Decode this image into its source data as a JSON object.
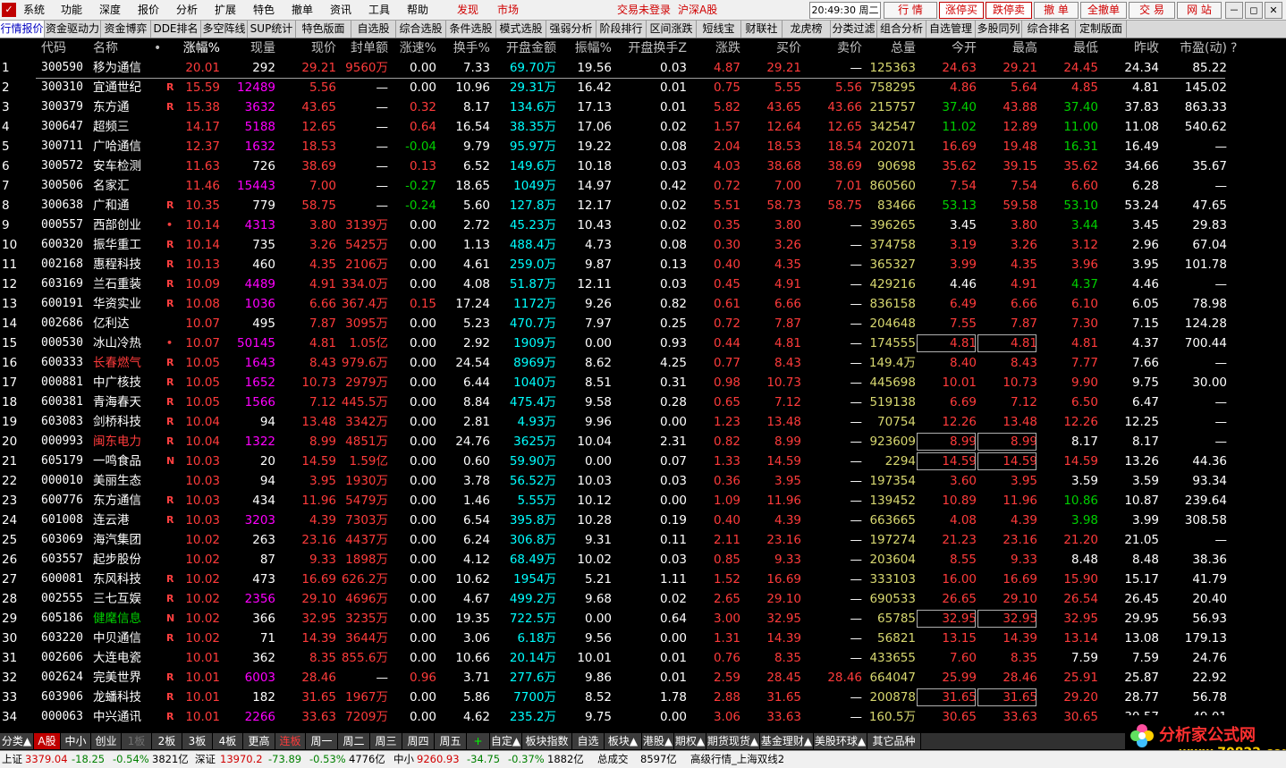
{
  "menu": {
    "items": [
      "系统",
      "功能",
      "深度",
      "报价",
      "分析",
      "扩展",
      "特色",
      "撤单",
      "资讯",
      "工具",
      "帮助"
    ],
    "discover": "发现",
    "market": "市场",
    "login_status": "交易未登录",
    "market_scope": "沪深A股",
    "clock": "20:49:30 周二",
    "buttons": [
      "行 情",
      "涨停买",
      "跌停卖",
      "撤 单",
      "全撤单",
      "交 易",
      "网 站"
    ],
    "win": [
      "－",
      "◻",
      "✕"
    ]
  },
  "tabs": [
    "行情报价",
    "资金驱动力",
    "资金博弈",
    "DDE排名",
    "多空阵线",
    "SUP统计",
    "特色版面",
    "自选股",
    "综合选股",
    "条件选股",
    "模式选股",
    "强弱分析",
    "阶段排行",
    "区间涨跌",
    "短线宝",
    "财联社",
    "龙虎榜",
    "分类过滤*",
    "组合分析",
    "自选管理",
    "多股同列",
    "综合排名",
    "定制版面"
  ],
  "columns": [
    "代码",
    "名称",
    "•",
    "涨幅%",
    "现量",
    "现价",
    "封单额",
    "涨速%",
    "换手%",
    "开盘金额",
    "振幅%",
    "开盘换手Z",
    "涨跌",
    "买价",
    "卖价",
    "总量",
    "今开",
    "最高",
    "最低",
    "昨收",
    "市盈(动)",
    "?"
  ],
  "rows": [
    {
      "i": "1",
      "code": "300590",
      "name": "移为通信",
      "f": "",
      "pct": "20.01",
      "vol": "292",
      "price": "29.21",
      "seal": "9560万",
      "spd": "0.00",
      "turn": "7.33",
      "amt": "69.70万",
      "amp": "19.56",
      "oturn": "0.03",
      "chg": "4.87",
      "bid": "29.21",
      "ask": "—",
      "tot": "125363",
      "open": "24.63",
      "high": "29.21",
      "low": "24.45",
      "prev": "24.34",
      "pe": "85.22"
    },
    {
      "i": "2",
      "code": "300310",
      "name": "宜通世纪",
      "f": "R",
      "pct": "15.59",
      "vol": "12489",
      "price": "5.56",
      "seal": "—",
      "spd": "0.00",
      "turn": "10.96",
      "amt": "29.31万",
      "amp": "16.42",
      "oturn": "0.01",
      "chg": "0.75",
      "bid": "5.55",
      "ask": "5.56",
      "tot": "758295",
      "open": "4.86",
      "high": "5.64",
      "low": "4.85",
      "prev": "4.81",
      "pe": "145.02"
    },
    {
      "i": "3",
      "code": "300379",
      "name": "东方通",
      "f": "R",
      "pct": "15.38",
      "vol": "3632",
      "price": "43.65",
      "seal": "—",
      "spd": "0.32",
      "turn": "8.17",
      "amt": "134.6万",
      "amp": "17.13",
      "oturn": "0.01",
      "chg": "5.82",
      "bid": "43.65",
      "ask": "43.66",
      "tot": "215757",
      "open": "37.40",
      "high": "43.88",
      "low": "37.40",
      "prev": "37.83",
      "pe": "863.33"
    },
    {
      "i": "4",
      "code": "300647",
      "name": "超频三",
      "f": "",
      "pct": "14.17",
      "vol": "5188",
      "price": "12.65",
      "seal": "—",
      "spd": "0.64",
      "turn": "16.54",
      "amt": "38.35万",
      "amp": "17.06",
      "oturn": "0.02",
      "chg": "1.57",
      "bid": "12.64",
      "ask": "12.65",
      "tot": "342547",
      "open": "11.02",
      "high": "12.89",
      "low": "11.00",
      "prev": "11.08",
      "pe": "540.62"
    },
    {
      "i": "5",
      "code": "300711",
      "name": "广哈通信",
      "f": "",
      "pct": "12.37",
      "vol": "1632",
      "price": "18.53",
      "seal": "—",
      "spd": "-0.04",
      "turn": "9.79",
      "amt": "95.97万",
      "amp": "19.22",
      "oturn": "0.08",
      "chg": "2.04",
      "bid": "18.53",
      "ask": "18.54",
      "tot": "202071",
      "open": "16.69",
      "high": "19.48",
      "low": "16.31",
      "prev": "16.49",
      "pe": "—"
    },
    {
      "i": "6",
      "code": "300572",
      "name": "安车检测",
      "f": "",
      "pct": "11.63",
      "vol": "726",
      "price": "38.69",
      "seal": "—",
      "spd": "0.13",
      "turn": "6.52",
      "amt": "149.6万",
      "amp": "10.18",
      "oturn": "0.03",
      "chg": "4.03",
      "bid": "38.68",
      "ask": "38.69",
      "tot": "90698",
      "open": "35.62",
      "high": "39.15",
      "low": "35.62",
      "prev": "34.66",
      "pe": "35.67"
    },
    {
      "i": "7",
      "code": "300506",
      "name": "名家汇",
      "f": "",
      "pct": "11.46",
      "vol": "15443",
      "price": "7.00",
      "seal": "—",
      "spd": "-0.27",
      "turn": "18.65",
      "amt": "1049万",
      "amp": "14.97",
      "oturn": "0.42",
      "chg": "0.72",
      "bid": "7.00",
      "ask": "7.01",
      "tot": "860560",
      "open": "7.54",
      "high": "7.54",
      "low": "6.60",
      "prev": "6.28",
      "pe": "—"
    },
    {
      "i": "8",
      "code": "300638",
      "name": "广和通",
      "f": "R",
      "pct": "10.35",
      "vol": "779",
      "price": "58.75",
      "seal": "—",
      "spd": "-0.24",
      "turn": "5.60",
      "amt": "127.8万",
      "amp": "12.17",
      "oturn": "0.02",
      "chg": "5.51",
      "bid": "58.73",
      "ask": "58.75",
      "tot": "83466",
      "open": "53.13",
      "high": "59.58",
      "low": "53.10",
      "prev": "53.24",
      "pe": "47.65"
    },
    {
      "i": "9",
      "code": "000557",
      "name": "西部创业",
      "f": "•",
      "pct": "10.14",
      "vol": "4313",
      "price": "3.80",
      "seal": "3139万",
      "spd": "0.00",
      "turn": "2.72",
      "amt": "45.23万",
      "amp": "10.43",
      "oturn": "0.02",
      "chg": "0.35",
      "bid": "3.80",
      "ask": "—",
      "tot": "396265",
      "open": "3.45",
      "high": "3.80",
      "low": "3.44",
      "prev": "3.45",
      "pe": "29.83"
    },
    {
      "i": "10",
      "code": "600320",
      "name": "振华重工",
      "f": "R",
      "pct": "10.14",
      "vol": "735",
      "price": "3.26",
      "seal": "5425万",
      "spd": "0.00",
      "turn": "1.13",
      "amt": "488.4万",
      "amp": "4.73",
      "oturn": "0.08",
      "chg": "0.30",
      "bid": "3.26",
      "ask": "—",
      "tot": "374758",
      "open": "3.19",
      "high": "3.26",
      "low": "3.12",
      "prev": "2.96",
      "pe": "67.04"
    },
    {
      "i": "11",
      "code": "002168",
      "name": "惠程科技",
      "f": "R",
      "pct": "10.13",
      "vol": "460",
      "price": "4.35",
      "seal": "2106万",
      "spd": "0.00",
      "turn": "4.61",
      "amt": "259.0万",
      "amp": "9.87",
      "oturn": "0.13",
      "chg": "0.40",
      "bid": "4.35",
      "ask": "—",
      "tot": "365327",
      "open": "3.99",
      "high": "4.35",
      "low": "3.96",
      "prev": "3.95",
      "pe": "101.78"
    },
    {
      "i": "12",
      "code": "603169",
      "name": "兰石重装",
      "f": "R",
      "pct": "10.09",
      "vol": "4489",
      "price": "4.91",
      "seal": "334.0万",
      "spd": "0.00",
      "turn": "4.08",
      "amt": "51.87万",
      "amp": "12.11",
      "oturn": "0.03",
      "chg": "0.45",
      "bid": "4.91",
      "ask": "—",
      "tot": "429216",
      "open": "4.46",
      "high": "4.91",
      "low": "4.37",
      "prev": "4.46",
      "pe": "—"
    },
    {
      "i": "13",
      "code": "600191",
      "name": "华资实业",
      "f": "R",
      "pct": "10.08",
      "vol": "1036",
      "price": "6.66",
      "seal": "367.4万",
      "spd": "0.15",
      "turn": "17.24",
      "amt": "1172万",
      "amp": "9.26",
      "oturn": "0.82",
      "chg": "0.61",
      "bid": "6.66",
      "ask": "—",
      "tot": "836158",
      "open": "6.49",
      "high": "6.66",
      "low": "6.10",
      "prev": "6.05",
      "pe": "78.98"
    },
    {
      "i": "14",
      "code": "002686",
      "name": "亿利达",
      "f": "",
      "pct": "10.07",
      "vol": "495",
      "price": "7.87",
      "seal": "3095万",
      "spd": "0.00",
      "turn": "5.23",
      "amt": "470.7万",
      "amp": "7.97",
      "oturn": "0.25",
      "chg": "0.72",
      "bid": "7.87",
      "ask": "—",
      "tot": "204648",
      "open": "7.55",
      "high": "7.87",
      "low": "7.30",
      "prev": "7.15",
      "pe": "124.28"
    },
    {
      "i": "15",
      "code": "000530",
      "name": "冰山冷热",
      "f": "•",
      "pct": "10.07",
      "vol": "50145",
      "price": "4.81",
      "seal": "1.05亿",
      "spd": "0.00",
      "turn": "2.92",
      "amt": "1909万",
      "amp": "0.00",
      "oturn": "0.93",
      "chg": "0.44",
      "bid": "4.81",
      "ask": "—",
      "tot": "174555",
      "open": "4.81",
      "high": "4.81",
      "low": "4.81",
      "prev": "4.37",
      "pe": "700.44"
    },
    {
      "i": "16",
      "code": "600333",
      "name": "长春燃气",
      "f": "R",
      "pct": "10.05",
      "vol": "1643",
      "price": "8.43",
      "seal": "979.6万",
      "spd": "0.00",
      "turn": "24.54",
      "amt": "8969万",
      "amp": "8.62",
      "oturn": "4.25",
      "chg": "0.77",
      "bid": "8.43",
      "ask": "—",
      "tot": "149.4万",
      "open": "8.40",
      "high": "8.43",
      "low": "7.77",
      "prev": "7.66",
      "pe": "—"
    },
    {
      "i": "17",
      "code": "000881",
      "name": "中广核技",
      "f": "R",
      "pct": "10.05",
      "vol": "1652",
      "price": "10.73",
      "seal": "2979万",
      "spd": "0.00",
      "turn": "6.44",
      "amt": "1040万",
      "amp": "8.51",
      "oturn": "0.31",
      "chg": "0.98",
      "bid": "10.73",
      "ask": "—",
      "tot": "445698",
      "open": "10.01",
      "high": "10.73",
      "low": "9.90",
      "prev": "9.75",
      "pe": "30.00"
    },
    {
      "i": "18",
      "code": "600381",
      "name": "青海春天",
      "f": "R",
      "pct": "10.05",
      "vol": "1566",
      "price": "7.12",
      "seal": "445.5万",
      "spd": "0.00",
      "turn": "8.84",
      "amt": "475.4万",
      "amp": "9.58",
      "oturn": "0.28",
      "chg": "0.65",
      "bid": "7.12",
      "ask": "—",
      "tot": "519138",
      "open": "6.69",
      "high": "7.12",
      "low": "6.50",
      "prev": "6.47",
      "pe": "—"
    },
    {
      "i": "19",
      "code": "603083",
      "name": "剑桥科技",
      "f": "R",
      "pct": "10.04",
      "vol": "94",
      "price": "13.48",
      "seal": "3342万",
      "spd": "0.00",
      "turn": "2.81",
      "amt": "4.93万",
      "amp": "9.96",
      "oturn": "0.00",
      "chg": "1.23",
      "bid": "13.48",
      "ask": "—",
      "tot": "70754",
      "open": "12.26",
      "high": "13.48",
      "low": "12.26",
      "prev": "12.25",
      "pe": "—"
    },
    {
      "i": "20",
      "code": "000993",
      "name": "闽东电力",
      "f": "R",
      "pct": "10.04",
      "vol": "1322",
      "price": "8.99",
      "seal": "4851万",
      "spd": "0.00",
      "turn": "24.76",
      "amt": "3625万",
      "amp": "10.04",
      "oturn": "2.31",
      "chg": "0.82",
      "bid": "8.99",
      "ask": "—",
      "tot": "923609",
      "open": "8.99",
      "high": "8.99",
      "low": "8.17",
      "prev": "8.17",
      "pe": "—"
    },
    {
      "i": "21",
      "code": "605179",
      "name": "一鸣食品",
      "f": "N",
      "pct": "10.03",
      "vol": "20",
      "price": "14.59",
      "seal": "1.59亿",
      "spd": "0.00",
      "turn": "0.60",
      "amt": "59.90万",
      "amp": "0.00",
      "oturn": "0.07",
      "chg": "1.33",
      "bid": "14.59",
      "ask": "—",
      "tot": "2294",
      "open": "14.59",
      "high": "14.59",
      "low": "14.59",
      "prev": "13.26",
      "pe": "44.36"
    },
    {
      "i": "22",
      "code": "000010",
      "name": "美丽生态",
      "f": "",
      "pct": "10.03",
      "vol": "94",
      "price": "3.95",
      "seal": "1930万",
      "spd": "0.00",
      "turn": "3.78",
      "amt": "56.52万",
      "amp": "10.03",
      "oturn": "0.03",
      "chg": "0.36",
      "bid": "3.95",
      "ask": "—",
      "tot": "197354",
      "open": "3.60",
      "high": "3.95",
      "low": "3.59",
      "prev": "3.59",
      "pe": "93.34"
    },
    {
      "i": "23",
      "code": "600776",
      "name": "东方通信",
      "f": "R",
      "pct": "10.03",
      "vol": "434",
      "price": "11.96",
      "seal": "5479万",
      "spd": "0.00",
      "turn": "1.46",
      "amt": "5.55万",
      "amp": "10.12",
      "oturn": "0.00",
      "chg": "1.09",
      "bid": "11.96",
      "ask": "—",
      "tot": "139452",
      "open": "10.89",
      "high": "11.96",
      "low": "10.86",
      "prev": "10.87",
      "pe": "239.64"
    },
    {
      "i": "24",
      "code": "601008",
      "name": "连云港",
      "f": "R",
      "pct": "10.03",
      "vol": "3203",
      "price": "4.39",
      "seal": "7303万",
      "spd": "0.00",
      "turn": "6.54",
      "amt": "395.8万",
      "amp": "10.28",
      "oturn": "0.19",
      "chg": "0.40",
      "bid": "4.39",
      "ask": "—",
      "tot": "663665",
      "open": "4.08",
      "high": "4.39",
      "low": "3.98",
      "prev": "3.99",
      "pe": "308.58"
    },
    {
      "i": "25",
      "code": "603069",
      "name": "海汽集团",
      "f": "",
      "pct": "10.02",
      "vol": "263",
      "price": "23.16",
      "seal": "4437万",
      "spd": "0.00",
      "turn": "6.24",
      "amt": "306.8万",
      "amp": "9.31",
      "oturn": "0.11",
      "chg": "2.11",
      "bid": "23.16",
      "ask": "—",
      "tot": "197274",
      "open": "21.23",
      "high": "23.16",
      "low": "21.20",
      "prev": "21.05",
      "pe": "—"
    },
    {
      "i": "26",
      "code": "603557",
      "name": "起步股份",
      "f": "",
      "pct": "10.02",
      "vol": "87",
      "price": "9.33",
      "seal": "1898万",
      "spd": "0.00",
      "turn": "4.12",
      "amt": "68.49万",
      "amp": "10.02",
      "oturn": "0.03",
      "chg": "0.85",
      "bid": "9.33",
      "ask": "—",
      "tot": "203604",
      "open": "8.55",
      "high": "9.33",
      "low": "8.48",
      "prev": "8.48",
      "pe": "38.36"
    },
    {
      "i": "27",
      "code": "600081",
      "name": "东风科技",
      "f": "R",
      "pct": "10.02",
      "vol": "473",
      "price": "16.69",
      "seal": "626.2万",
      "spd": "0.00",
      "turn": "10.62",
      "amt": "1954万",
      "amp": "5.21",
      "oturn": "1.11",
      "chg": "1.52",
      "bid": "16.69",
      "ask": "—",
      "tot": "333103",
      "open": "16.00",
      "high": "16.69",
      "low": "15.90",
      "prev": "15.17",
      "pe": "41.79"
    },
    {
      "i": "28",
      "code": "002555",
      "name": "三七互娱",
      "f": "R",
      "pct": "10.02",
      "vol": "2356",
      "price": "29.10",
      "seal": "4696万",
      "spd": "0.00",
      "turn": "4.67",
      "amt": "499.2万",
      "amp": "9.68",
      "oturn": "0.02",
      "chg": "2.65",
      "bid": "29.10",
      "ask": "—",
      "tot": "690533",
      "open": "26.65",
      "high": "29.10",
      "low": "26.54",
      "prev": "26.45",
      "pe": "20.40"
    },
    {
      "i": "29",
      "code": "605186",
      "name": "健麾信息",
      "f": "N",
      "pct": "10.02",
      "vol": "366",
      "price": "32.95",
      "seal": "3235万",
      "spd": "0.00",
      "turn": "19.35",
      "amt": "722.5万",
      "amp": "0.00",
      "oturn": "0.64",
      "chg": "3.00",
      "bid": "32.95",
      "ask": "—",
      "tot": "65785",
      "open": "32.95",
      "high": "32.95",
      "low": "32.95",
      "prev": "29.95",
      "pe": "56.93"
    },
    {
      "i": "30",
      "code": "603220",
      "name": "中贝通信",
      "f": "R",
      "pct": "10.02",
      "vol": "71",
      "price": "14.39",
      "seal": "3644万",
      "spd": "0.00",
      "turn": "3.06",
      "amt": "6.18万",
      "amp": "9.56",
      "oturn": "0.00",
      "chg": "1.31",
      "bid": "14.39",
      "ask": "—",
      "tot": "56821",
      "open": "13.15",
      "high": "14.39",
      "low": "13.14",
      "prev": "13.08",
      "pe": "179.13"
    },
    {
      "i": "31",
      "code": "002606",
      "name": "大连电瓷",
      "f": "",
      "pct": "10.01",
      "vol": "362",
      "price": "8.35",
      "seal": "855.6万",
      "spd": "0.00",
      "turn": "10.66",
      "amt": "20.14万",
      "amp": "10.01",
      "oturn": "0.01",
      "chg": "0.76",
      "bid": "8.35",
      "ask": "—",
      "tot": "433655",
      "open": "7.60",
      "high": "8.35",
      "low": "7.59",
      "prev": "7.59",
      "pe": "24.76"
    },
    {
      "i": "32",
      "code": "002624",
      "name": "完美世界",
      "f": "R",
      "pct": "10.01",
      "vol": "6003",
      "price": "28.46",
      "seal": "—",
      "spd": "0.96",
      "turn": "3.71",
      "amt": "277.6万",
      "amp": "9.86",
      "oturn": "0.01",
      "chg": "2.59",
      "bid": "28.45",
      "ask": "28.46",
      "tot": "664047",
      "open": "25.99",
      "high": "28.46",
      "low": "25.91",
      "prev": "25.87",
      "pe": "22.92"
    },
    {
      "i": "33",
      "code": "603906",
      "name": "龙蟠科技",
      "f": "R",
      "pct": "10.01",
      "vol": "182",
      "price": "31.65",
      "seal": "1967万",
      "spd": "0.00",
      "turn": "5.86",
      "amt": "7700万",
      "amp": "8.52",
      "oturn": "1.78",
      "chg": "2.88",
      "bid": "31.65",
      "ask": "—",
      "tot": "200878",
      "open": "31.65",
      "high": "31.65",
      "low": "29.20",
      "prev": "28.77",
      "pe": "56.78"
    },
    {
      "i": "34",
      "code": "000063",
      "name": "中兴通讯",
      "f": "R",
      "pct": "10.01",
      "vol": "2266",
      "price": "33.63",
      "seal": "7209万",
      "spd": "0.00",
      "turn": "4.62",
      "amt": "235.2万",
      "amp": "9.75",
      "oturn": "0.00",
      "chg": "3.06",
      "bid": "33.63",
      "ask": "—",
      "tot": "160.5万",
      "open": "30.65",
      "high": "33.63",
      "low": "30.65",
      "prev": "30.57",
      "pe": "49.01"
    }
  ],
  "bottom_tabs": [
    "分类▲",
    "A股",
    "中小",
    "创业",
    "1板",
    "2板",
    "3板",
    "4板",
    "更高",
    "连板",
    "周一",
    "周二",
    "周三",
    "周四",
    "周五",
    "+",
    "自定▲",
    "板块指数",
    "自选",
    "板块▲",
    "港股▲",
    "期权▲",
    "期货现货▲",
    "基金理财▲",
    "美股环球▲",
    "其它品种"
  ],
  "brand": {
    "name": "分析家公式网",
    "url": "www.70822.com"
  },
  "status": {
    "sh_label": "上证",
    "sh_val": "3379.04",
    "sh_chg": "-18.25",
    "sh_pct": "-0.54%",
    "sh_amt": "3821亿",
    "sz_label": "深证",
    "sz_val": "13970.2",
    "sz_chg": "-73.89",
    "sz_pct": "-0.53%",
    "sz_amt": "4776亿",
    "zx_label": "中小",
    "zx_val": "9260.93",
    "zx_chg": "-34.75",
    "zx_pct": "-0.37%",
    "zx_amt": "1882亿",
    "total_label": "总成交",
    "total_val": "8597亿",
    "server": "高级行情_上海双线2"
  }
}
